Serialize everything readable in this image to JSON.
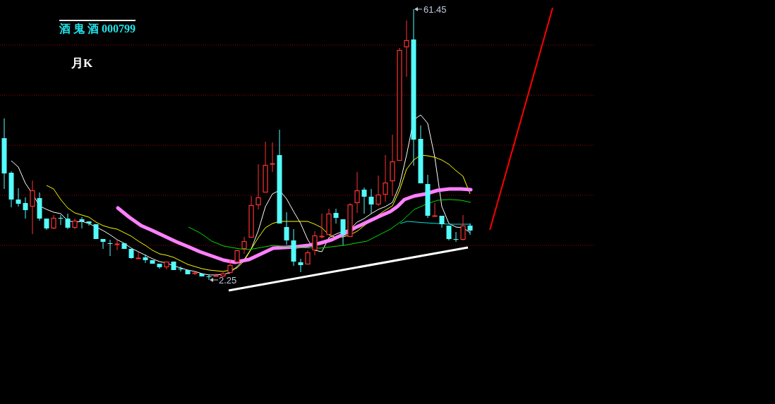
{
  "chart": {
    "title": "酒 鬼 酒 000799",
    "period_label": "月K",
    "high_price_label": "61.45",
    "low_price_label": "2.25"
  }
}
